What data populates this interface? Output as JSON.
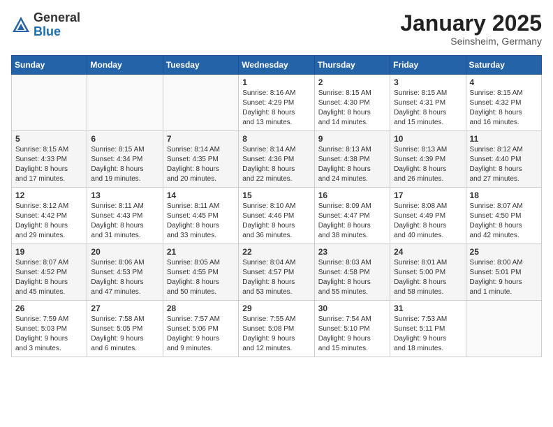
{
  "logo": {
    "general": "General",
    "blue": "Blue"
  },
  "header": {
    "month": "January 2025",
    "location": "Seinsheim, Germany"
  },
  "weekdays": [
    "Sunday",
    "Monday",
    "Tuesday",
    "Wednesday",
    "Thursday",
    "Friday",
    "Saturday"
  ],
  "weeks": [
    [
      {
        "day": "",
        "info": ""
      },
      {
        "day": "",
        "info": ""
      },
      {
        "day": "",
        "info": ""
      },
      {
        "day": "1",
        "info": "Sunrise: 8:16 AM\nSunset: 4:29 PM\nDaylight: 8 hours\nand 13 minutes."
      },
      {
        "day": "2",
        "info": "Sunrise: 8:15 AM\nSunset: 4:30 PM\nDaylight: 8 hours\nand 14 minutes."
      },
      {
        "day": "3",
        "info": "Sunrise: 8:15 AM\nSunset: 4:31 PM\nDaylight: 8 hours\nand 15 minutes."
      },
      {
        "day": "4",
        "info": "Sunrise: 8:15 AM\nSunset: 4:32 PM\nDaylight: 8 hours\nand 16 minutes."
      }
    ],
    [
      {
        "day": "5",
        "info": "Sunrise: 8:15 AM\nSunset: 4:33 PM\nDaylight: 8 hours\nand 17 minutes."
      },
      {
        "day": "6",
        "info": "Sunrise: 8:15 AM\nSunset: 4:34 PM\nDaylight: 8 hours\nand 19 minutes."
      },
      {
        "day": "7",
        "info": "Sunrise: 8:14 AM\nSunset: 4:35 PM\nDaylight: 8 hours\nand 20 minutes."
      },
      {
        "day": "8",
        "info": "Sunrise: 8:14 AM\nSunset: 4:36 PM\nDaylight: 8 hours\nand 22 minutes."
      },
      {
        "day": "9",
        "info": "Sunrise: 8:13 AM\nSunset: 4:38 PM\nDaylight: 8 hours\nand 24 minutes."
      },
      {
        "day": "10",
        "info": "Sunrise: 8:13 AM\nSunset: 4:39 PM\nDaylight: 8 hours\nand 26 minutes."
      },
      {
        "day": "11",
        "info": "Sunrise: 8:12 AM\nSunset: 4:40 PM\nDaylight: 8 hours\nand 27 minutes."
      }
    ],
    [
      {
        "day": "12",
        "info": "Sunrise: 8:12 AM\nSunset: 4:42 PM\nDaylight: 8 hours\nand 29 minutes."
      },
      {
        "day": "13",
        "info": "Sunrise: 8:11 AM\nSunset: 4:43 PM\nDaylight: 8 hours\nand 31 minutes."
      },
      {
        "day": "14",
        "info": "Sunrise: 8:11 AM\nSunset: 4:45 PM\nDaylight: 8 hours\nand 33 minutes."
      },
      {
        "day": "15",
        "info": "Sunrise: 8:10 AM\nSunset: 4:46 PM\nDaylight: 8 hours\nand 36 minutes."
      },
      {
        "day": "16",
        "info": "Sunrise: 8:09 AM\nSunset: 4:47 PM\nDaylight: 8 hours\nand 38 minutes."
      },
      {
        "day": "17",
        "info": "Sunrise: 8:08 AM\nSunset: 4:49 PM\nDaylight: 8 hours\nand 40 minutes."
      },
      {
        "day": "18",
        "info": "Sunrise: 8:07 AM\nSunset: 4:50 PM\nDaylight: 8 hours\nand 42 minutes."
      }
    ],
    [
      {
        "day": "19",
        "info": "Sunrise: 8:07 AM\nSunset: 4:52 PM\nDaylight: 8 hours\nand 45 minutes."
      },
      {
        "day": "20",
        "info": "Sunrise: 8:06 AM\nSunset: 4:53 PM\nDaylight: 8 hours\nand 47 minutes."
      },
      {
        "day": "21",
        "info": "Sunrise: 8:05 AM\nSunset: 4:55 PM\nDaylight: 8 hours\nand 50 minutes."
      },
      {
        "day": "22",
        "info": "Sunrise: 8:04 AM\nSunset: 4:57 PM\nDaylight: 8 hours\nand 53 minutes."
      },
      {
        "day": "23",
        "info": "Sunrise: 8:03 AM\nSunset: 4:58 PM\nDaylight: 8 hours\nand 55 minutes."
      },
      {
        "day": "24",
        "info": "Sunrise: 8:01 AM\nSunset: 5:00 PM\nDaylight: 8 hours\nand 58 minutes."
      },
      {
        "day": "25",
        "info": "Sunrise: 8:00 AM\nSunset: 5:01 PM\nDaylight: 9 hours\nand 1 minute."
      }
    ],
    [
      {
        "day": "26",
        "info": "Sunrise: 7:59 AM\nSunset: 5:03 PM\nDaylight: 9 hours\nand 3 minutes."
      },
      {
        "day": "27",
        "info": "Sunrise: 7:58 AM\nSunset: 5:05 PM\nDaylight: 9 hours\nand 6 minutes."
      },
      {
        "day": "28",
        "info": "Sunrise: 7:57 AM\nSunset: 5:06 PM\nDaylight: 9 hours\nand 9 minutes."
      },
      {
        "day": "29",
        "info": "Sunrise: 7:55 AM\nSunset: 5:08 PM\nDaylight: 9 hours\nand 12 minutes."
      },
      {
        "day": "30",
        "info": "Sunrise: 7:54 AM\nSunset: 5:10 PM\nDaylight: 9 hours\nand 15 minutes."
      },
      {
        "day": "31",
        "info": "Sunrise: 7:53 AM\nSunset: 5:11 PM\nDaylight: 9 hours\nand 18 minutes."
      },
      {
        "day": "",
        "info": ""
      }
    ]
  ]
}
